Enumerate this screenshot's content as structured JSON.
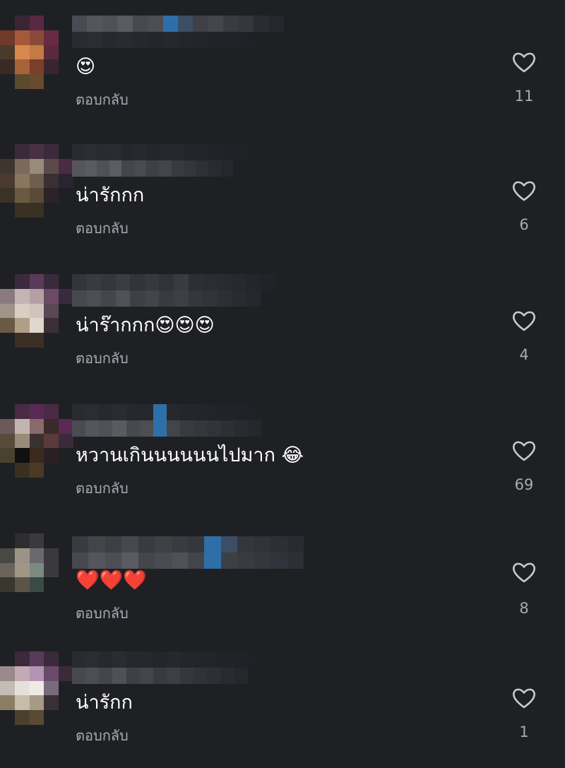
{
  "comments": [
    {
      "text": "😍",
      "reply_label": "ตอบกลับ",
      "likes": "11"
    },
    {
      "text": "น่ารักกก",
      "reply_label": "ตอบกลับ",
      "likes": "6"
    },
    {
      "text": "น่าร๊ากกก😍😍😍",
      "reply_label": "ตอบกลับ",
      "likes": "4"
    },
    {
      "text": "หวานเกินนนนนนไปมาก 😂",
      "reply_label": "ตอบกลับ",
      "likes": "69"
    },
    {
      "text": "❤️❤️❤️",
      "reply_label": "ตอบกลับ",
      "likes": "8"
    },
    {
      "text": "น่ารักก",
      "reply_label": "ตอบกลับ",
      "likes": "1"
    }
  ],
  "icons": {
    "like": "heart-outline-icon"
  },
  "colors": {
    "background": "#1f2024",
    "secondary_text": "#a9abb2",
    "primary_text": "#ffffff"
  }
}
